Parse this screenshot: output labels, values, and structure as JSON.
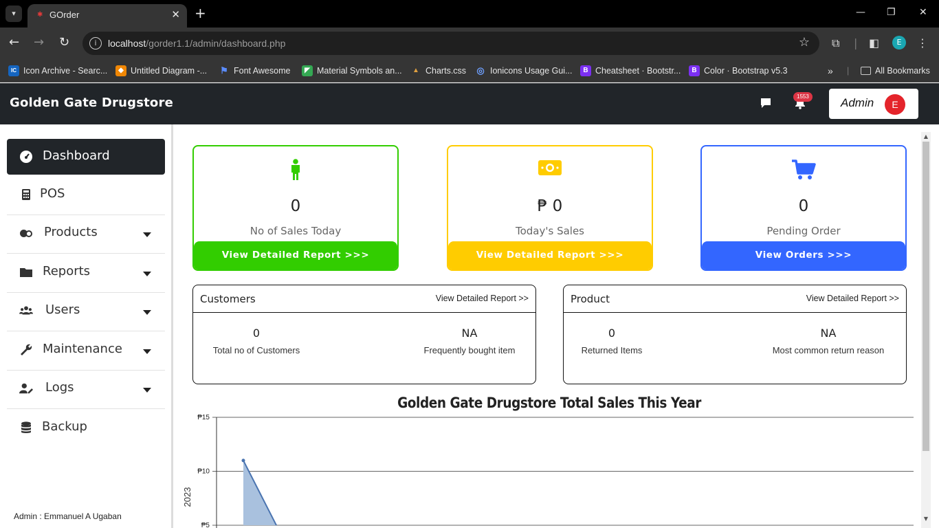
{
  "browser": {
    "tab_title": "GOrder",
    "url_host": "localhost",
    "url_path": "/gorder1.1/admin/dashboard.php",
    "profile_initial": "E",
    "bookmarks": [
      {
        "label": "Icon Archive - Searc...",
        "icon": "IC",
        "color": "#1565c0"
      },
      {
        "label": "Untitled Diagram -...",
        "icon": "◆",
        "color": "#f08705"
      },
      {
        "label": "Font Awesome",
        "icon": "⚑",
        "color": "#3d6fd8"
      },
      {
        "label": "Material Symbols an...",
        "icon": "◤",
        "color": "#34a853"
      },
      {
        "label": "Charts.css",
        "icon": "▲",
        "color": "#888888"
      },
      {
        "label": "Ionicons Usage Gui...",
        "icon": "◎",
        "color": "#3880ff"
      },
      {
        "label": "Cheatsheet · Bootstr...",
        "icon": "B",
        "color": "#7b2ff2"
      },
      {
        "label": "Color · Bootstrap v5.3",
        "icon": "B",
        "color": "#7b2ff2"
      }
    ],
    "all_bookmarks": "All Bookmarks"
  },
  "header": {
    "brand": "Golden Gate Drugstore",
    "notification_count": "1553",
    "admin_label": "Admin",
    "admin_initial": "E"
  },
  "sidebar": {
    "items": [
      {
        "label": "Dashboard"
      },
      {
        "label": "POS"
      },
      {
        "label": "Products"
      },
      {
        "label": "Reports"
      },
      {
        "label": "Users"
      },
      {
        "label": "Maintenance"
      },
      {
        "label": "Logs"
      },
      {
        "label": "Backup"
      }
    ],
    "footer": "Admin : Emmanuel A Ugaban"
  },
  "cards": [
    {
      "value": "0",
      "label": "No of Sales Today",
      "button": "View Detailed Report >>>",
      "color": "#32cd00"
    },
    {
      "value": "₱ 0",
      "label": "Today's Sales",
      "button": "View Detailed Report >>>",
      "color": "#ffcc00"
    },
    {
      "value": "0",
      "label": "Pending Order",
      "button": "View Orders >>>",
      "color": "#3366ff"
    }
  ],
  "panels": {
    "customers": {
      "title": "Customers",
      "link": "View Detailed Report >>",
      "stat1_value": "0",
      "stat1_label": "Total no of Customers",
      "stat2_value": "NA",
      "stat2_label": "Frequently bought item"
    },
    "product": {
      "title": "Product",
      "link": "View Detailed Report >>",
      "stat1_value": "0",
      "stat1_label": "Returned Items",
      "stat2_value": "NA",
      "stat2_label": "Most common return reason"
    }
  },
  "chart_data": {
    "type": "area",
    "title": "Golden Gate Drugstore Total Sales This Year",
    "ylabel": "2023",
    "y_ticks": [
      "₱15",
      "₱10",
      "₱5"
    ],
    "ylim": [
      5,
      15
    ],
    "series": [
      {
        "values": [
          11,
          5
        ]
      }
    ],
    "grid": true,
    "fill_color": "#a9c1de",
    "line_color": "#4a74b0"
  }
}
